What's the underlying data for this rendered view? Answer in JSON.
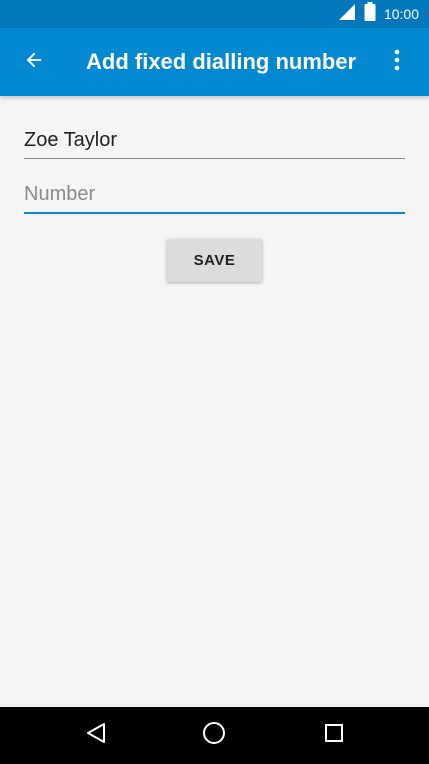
{
  "status_bar": {
    "time": "10:00",
    "icons": [
      "signal-icon",
      "battery-icon"
    ]
  },
  "app_bar": {
    "title": "Add fixed dialling number",
    "back_icon": "arrow-left-icon",
    "overflow_icon": "more-vert-icon"
  },
  "form": {
    "name_value": "Zoe Taylor",
    "number_placeholder": "Number",
    "save_label": "SAVE"
  },
  "nav_bar": {
    "icons": [
      "back-triangle-icon",
      "home-circle-icon",
      "recents-square-icon"
    ]
  },
  "colors": {
    "status_bar": "#0277bd",
    "app_bar": "#0288d1",
    "accent": "#0288d1",
    "background": "#f5f5f5",
    "button": "#dcdcdc"
  }
}
